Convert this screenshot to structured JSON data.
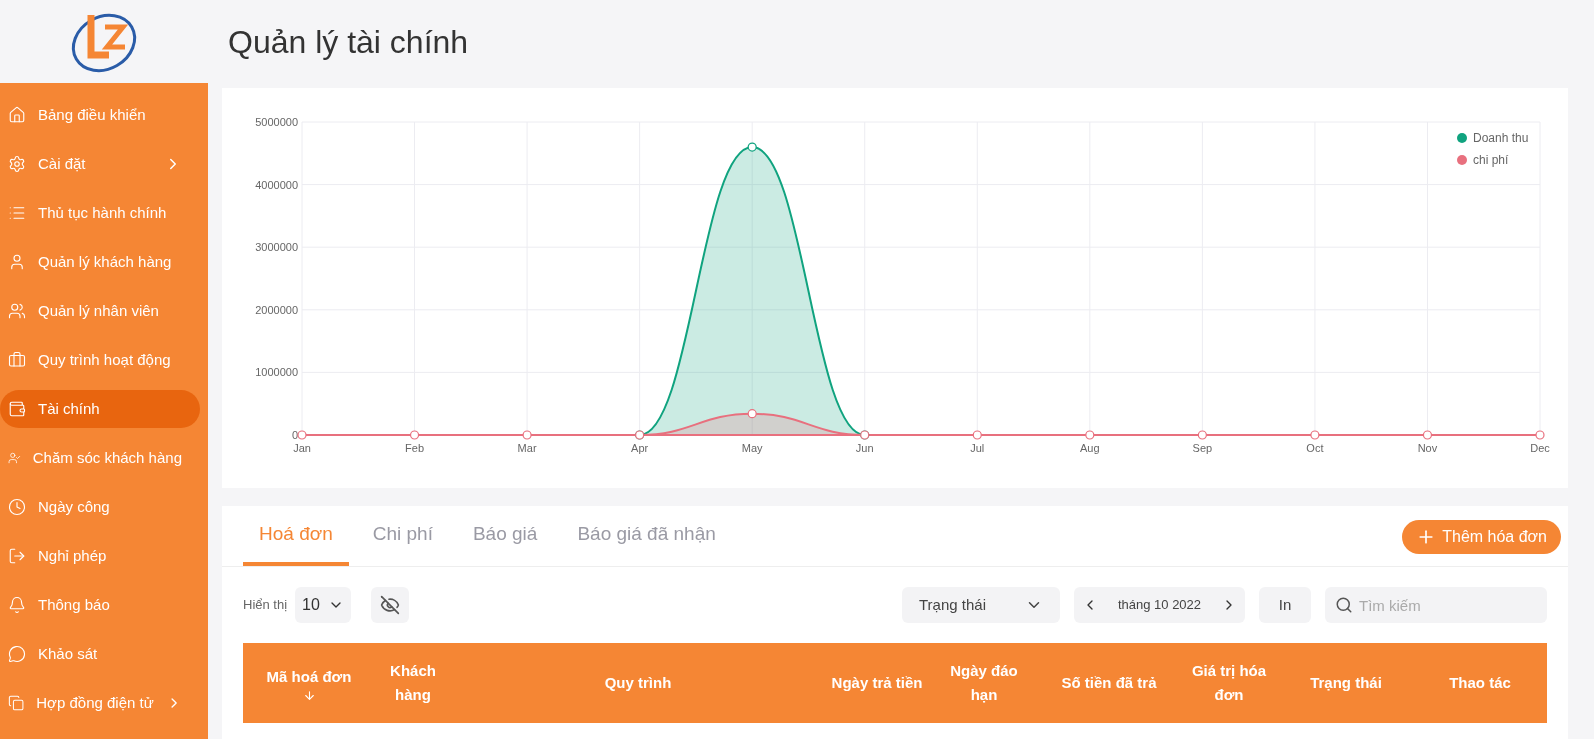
{
  "page": {
    "title": "Quản lý tài chính"
  },
  "sidebar": {
    "items": [
      {
        "kind": "home",
        "label": "Bảng điều khiển",
        "selected": false,
        "expandable": false
      },
      {
        "kind": "settings",
        "label": "Cài đặt",
        "selected": false,
        "expandable": true
      },
      {
        "kind": "list",
        "label": "Thủ tục hành chính",
        "selected": false,
        "expandable": false
      },
      {
        "kind": "user",
        "label": "Quản lý khách hàng",
        "selected": false,
        "expandable": false
      },
      {
        "kind": "users",
        "label": "Quản lý nhân viên",
        "selected": false,
        "expandable": false
      },
      {
        "kind": "briefcase",
        "label": "Quy trình hoạt động",
        "selected": false,
        "expandable": false
      },
      {
        "kind": "wallet",
        "label": "Tài chính",
        "selected": true,
        "expandable": false
      },
      {
        "kind": "care",
        "label": "Chăm sóc khách hàng",
        "selected": false,
        "expandable": false
      },
      {
        "kind": "clock",
        "label": "Ngày công",
        "selected": false,
        "expandable": false
      },
      {
        "kind": "logout",
        "label": "Nghỉ phép",
        "selected": false,
        "expandable": false
      },
      {
        "kind": "bell",
        "label": "Thông báo",
        "selected": false,
        "expandable": false
      },
      {
        "kind": "chat",
        "label": "Khảo sát",
        "selected": false,
        "expandable": false
      },
      {
        "kind": "contract",
        "label": "Hợp đồng điện tử",
        "selected": false,
        "expandable": true
      }
    ]
  },
  "chart": {
    "chart_data": {
      "type": "area",
      "categories": [
        "Jan",
        "Feb",
        "Mar",
        "Apr",
        "May",
        "Jun",
        "Jul",
        "Aug",
        "Sep",
        "Oct",
        "Nov",
        "Dec"
      ],
      "series": [
        {
          "name": "Doanh thu",
          "color": "#10a37f",
          "marker": "circle",
          "values": [
            null,
            null,
            null,
            0,
            4600000,
            0,
            null,
            null,
            null,
            null,
            null,
            null
          ]
        },
        {
          "name": "chi phí",
          "color": "#e8707e",
          "marker": "circle",
          "values": [
            0,
            0,
            0,
            0,
            340000,
            0,
            0,
            0,
            0,
            0,
            0,
            0
          ]
        }
      ],
      "grid": true,
      "legend": true,
      "ylim": [
        0,
        5000000
      ],
      "yticks": [
        0,
        1000000,
        2000000,
        3000000,
        4000000,
        5000000
      ]
    }
  },
  "tabs": [
    {
      "label": "Hoá đơn",
      "selected": true
    },
    {
      "label": "Chi phí",
      "selected": false
    },
    {
      "label": "Báo giá",
      "selected": false
    },
    {
      "label": "Báo giá đã nhận",
      "selected": false
    }
  ],
  "add_button": "Thêm hóa đơn",
  "toolbar": {
    "show_label": "Hiển thị",
    "page_size": "10",
    "status_filter": "Trạng thái",
    "month": "tháng 10 2022",
    "print_button": "In",
    "search": {
      "placeholder": "Tìm kiếm"
    }
  },
  "table": {
    "columns": [
      {
        "label": "Mã hoá đơn",
        "sorted": true
      },
      {
        "label": "Khách hàng",
        "sorted": false
      },
      {
        "label": "Quy trình",
        "sorted": false
      },
      {
        "label": "Ngày trả tiền",
        "sorted": false
      },
      {
        "label": "Ngày đáo hạn",
        "sorted": false
      },
      {
        "label": "Số tiền đã trả",
        "sorted": false
      },
      {
        "label": "Giá trị hóa đơn",
        "sorted": false
      },
      {
        "label": "Trạng thái",
        "sorted": false
      },
      {
        "label": "Thao tác",
        "sorted": false
      }
    ]
  }
}
